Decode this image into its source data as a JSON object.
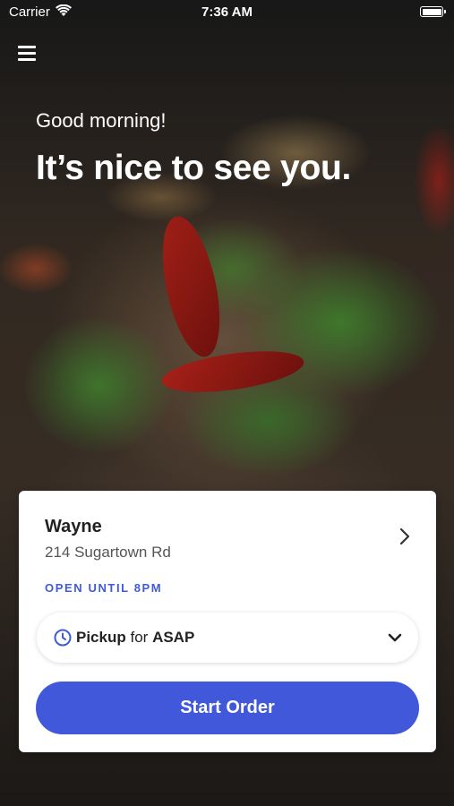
{
  "status_bar": {
    "carrier": "Carrier",
    "time": "7:36 AM",
    "wifi_icon": "wifi-icon",
    "battery_icon": "battery-icon"
  },
  "header": {
    "menu_icon": "hamburger-menu-icon",
    "greeting": "Good morning!",
    "headline": "It’s nice to see you."
  },
  "location_card": {
    "name": "Wayne",
    "address": "214 Sugartown Rd",
    "hours": "OPEN UNTIL 8PM",
    "chevron_icon": "chevron-right-icon",
    "order_type": {
      "mode": "Pickup",
      "connector": "for",
      "time": "ASAP",
      "clock_icon": "clock-icon",
      "dropdown_icon": "chevron-down-icon"
    },
    "start_button": "Start Order"
  },
  "colors": {
    "accent": "#4058d9",
    "hours_text": "#3f5bd9",
    "card_background": "#ffffff"
  }
}
